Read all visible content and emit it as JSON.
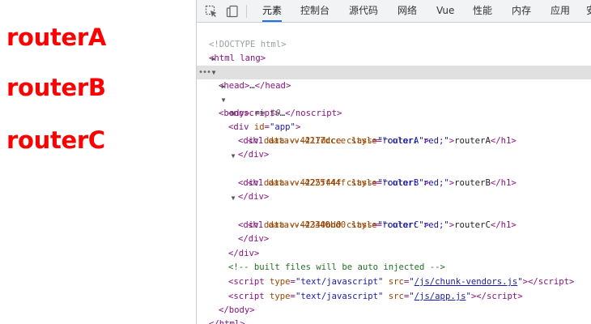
{
  "page": {
    "headings": [
      "routerA",
      "routerB",
      "routerC"
    ]
  },
  "devtools": {
    "tabs": [
      "元素",
      "控制台",
      "源代码",
      "网络",
      "Vue",
      "性能",
      "内存",
      "应用",
      "安"
    ],
    "active_tab": "元素",
    "icons": [
      "inspect-element-icon",
      "device-toolbar-icon"
    ],
    "dom": {
      "doctype": "<!DOCTYPE html>",
      "html_open": "<html lang>",
      "head": {
        "open": "<head>",
        "ellipsis": "…",
        "close": "</head>"
      },
      "body_open": "<body>",
      "body_eq": " == ",
      "body_sel": "$0",
      "noscript": {
        "open": "<noscript>",
        "ellipsis": "…",
        "close": "</noscript>"
      },
      "app_div": {
        "tag": "<div ",
        "attr": "id",
        "value": "\"app\"",
        "end": ">"
      },
      "routers": [
        {
          "div_attr": "data-v-4217dcce",
          "class_val": "\"routerA\"",
          "h1_attr": "data-v-4217dcce",
          "style_val": "\"color: red;\"",
          "text": "routerA"
        },
        {
          "div_attr": "data-v-4225f44f",
          "class_val": "\"routerB\"",
          "h1_attr": "data-v-4225f44f",
          "style_val": "\"color: red;\"",
          "text": "routerB"
        },
        {
          "div_attr": "data-v-42340bd0",
          "class_val": "\"routerC\"",
          "h1_attr": "data-v-42340bd0",
          "style_val": "\"color: red;\"",
          "text": "routerC"
        }
      ],
      "div_close": "</div>",
      "comment": "<!-- built files will be auto injected -->",
      "scripts": [
        {
          "type_val": "\"text/javascript\"",
          "src": "/js/chunk-vendors.js"
        },
        {
          "type_val": "\"text/javascript\"",
          "src": "/js/app.js"
        }
      ],
      "body_close": "</body>",
      "html_close": "</html>"
    }
  }
}
